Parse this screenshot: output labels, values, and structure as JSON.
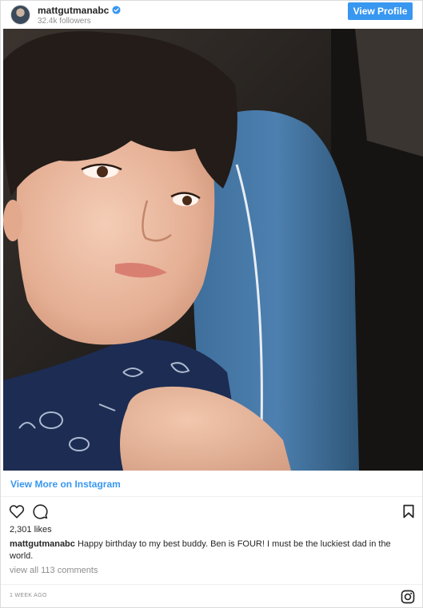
{
  "header": {
    "username": "mattgutmanabc",
    "followers": "32.4k followers",
    "view_profile_label": "View Profile"
  },
  "post": {
    "view_more_label": "View More on Instagram",
    "likes": "2,301 likes",
    "caption_user": "mattgutmanabc",
    "caption_text": "Happy birthday to my best buddy. Ben is FOUR! I must be the luckiest dad in the world.",
    "comments_link": "view all 113 comments",
    "timestamp": "1 WEEK AGO"
  },
  "icons": {
    "verified": "verified-badge-icon",
    "like": "heart-icon",
    "comment": "comment-bubble-icon",
    "save": "bookmark-icon",
    "instagram": "instagram-logo-icon"
  },
  "colors": {
    "accent": "#3897f0",
    "text": "#262626",
    "muted": "#8e8e8e"
  }
}
